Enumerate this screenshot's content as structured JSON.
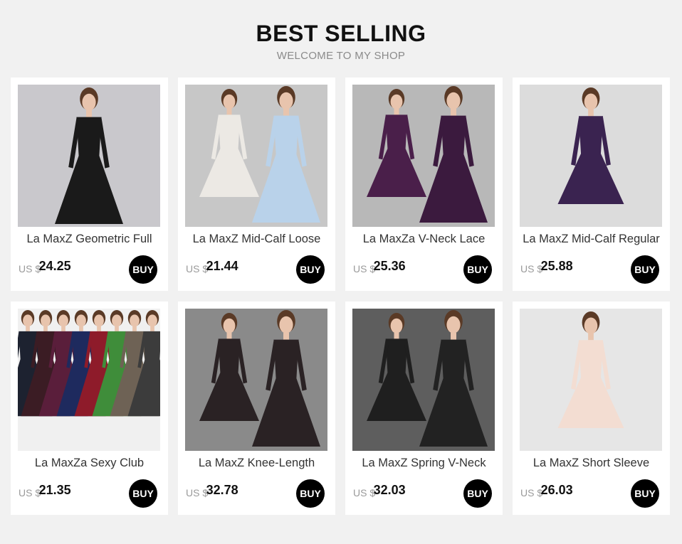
{
  "header": {
    "title": "BEST SELLING",
    "subtitle": "WELCOME TO MY SHOP"
  },
  "products": [
    {
      "name": "La MaxZ Geometric Full",
      "currency": "US $",
      "price": "24.25",
      "buy": "BUY",
      "bg": "#c9c8cc",
      "dress": "#1a1a1a",
      "style": "long"
    },
    {
      "name": "La MaxZ Mid-Calf Loose",
      "currency": "US $",
      "price": "21.44",
      "buy": "BUY",
      "bg": "#c7c7c7",
      "dress": "#ece9e4",
      "dress2": "#b9d2ea",
      "style": "pair"
    },
    {
      "name": "La MaxZa V-Neck Lace",
      "currency": "US $",
      "price": "25.36",
      "buy": "BUY",
      "bg": "#b8b8b8",
      "dress": "#4a1f4a",
      "dress2": "#3b1a3e",
      "style": "pair"
    },
    {
      "name": "La MaxZ Mid-Calf Regular",
      "currency": "US $",
      "price": "25.88",
      "buy": "BUY",
      "bg": "#dcdcdc",
      "dress": "#3a2350",
      "style": "midi"
    },
    {
      "name": "La MaxZa Sexy Club",
      "currency": "US $",
      "price": "21.35",
      "buy": "BUY",
      "bg": "#f0f0f0",
      "dress": "#1d2230",
      "style": "row"
    },
    {
      "name": "La MaxZ Knee-Length",
      "currency": "US $",
      "price": "32.78",
      "buy": "BUY",
      "bg": "#8a8a8a",
      "dress": "#2a2224",
      "dress2": "#2a2224",
      "style": "pair"
    },
    {
      "name": "La MaxZ Spring V-Neck",
      "currency": "US $",
      "price": "32.03",
      "buy": "BUY",
      "bg": "#5e5e5e",
      "dress": "#1f1f1f",
      "dress2": "#222",
      "style": "pair"
    },
    {
      "name": "La MaxZ Short Sleeve",
      "currency": "US $",
      "price": "26.03",
      "buy": "BUY",
      "bg": "#e6e6e6",
      "dress": "#f3ddd2",
      "style": "midi"
    }
  ]
}
